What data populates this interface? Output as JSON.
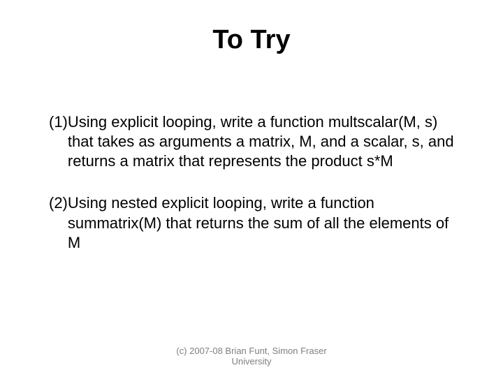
{
  "title": "To Try",
  "items": [
    {
      "num": "(1)",
      "text": "Using explicit looping, write a function multscalar(M, s) that takes as arguments a matrix, M, and a scalar, s, and returns a matrix that represents the product s*M"
    },
    {
      "num": "(2)",
      "text": "Using nested explicit looping, write a function summatrix(M) that returns the sum of all the elements of M"
    }
  ],
  "footer_line1": "(c) 2007-08  Brian Funt, Simon Fraser",
  "footer_line2": "University"
}
